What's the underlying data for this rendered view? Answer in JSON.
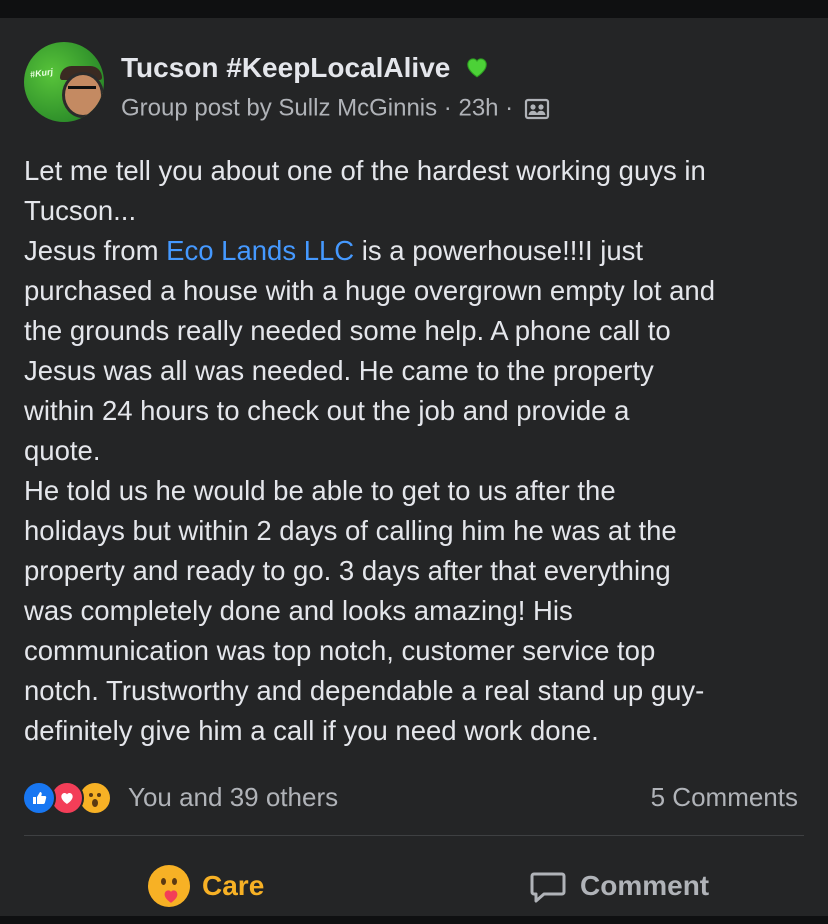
{
  "post": {
    "group_name": "Tucson #KeepLocalAlive",
    "avatar_sticker": "#Kurj",
    "meta_prefix": "Group post by ",
    "author": "Sullz McGinnis",
    "separator": " · ",
    "time": "23h",
    "separator2": " · ",
    "body_lines": [
      [
        "Let me tell you about one of the hardest working guys in"
      ],
      [
        "Tucson..."
      ],
      [
        "Jesus from ",
        "Eco Lands LLC",
        " is a powerhouse!!!I just"
      ],
      [
        "purchased a house with a huge overgrown empty lot and"
      ],
      [
        "the grounds really needed some help. A phone call to"
      ],
      [
        "Jesus was all was needed. He came to the property"
      ],
      [
        "within 24 hours to check out the job and provide a"
      ],
      [
        "quote."
      ],
      [
        "He told us he would be able to get to us after the"
      ],
      [
        "holidays but within 2 days of calling him he was at the"
      ],
      [
        "property and ready to go. 3 days after that everything"
      ],
      [
        "was completely done and looks amazing! His"
      ],
      [
        "communication was top notch, customer service top"
      ],
      [
        "notch. Trustworthy and dependable a real stand up guy-"
      ],
      [
        "definitely give him a call if you need work done."
      ]
    ],
    "link_text": "Eco Lands LLC",
    "reactions_text": "You and 39 others",
    "reaction_icons": [
      "like-icon",
      "love-icon",
      "wow-icon"
    ],
    "comments_count": "5 Comments",
    "actions": {
      "care_label": "Care",
      "comment_label": "Comment"
    }
  },
  "colors": {
    "background": "#18191a",
    "card": "#242526",
    "text": "#e4e6eb",
    "secondary_text": "#b0b3b8",
    "link": "#4599ff",
    "care": "#f7b125",
    "like": "#1877f2",
    "love": "#f33e58"
  }
}
